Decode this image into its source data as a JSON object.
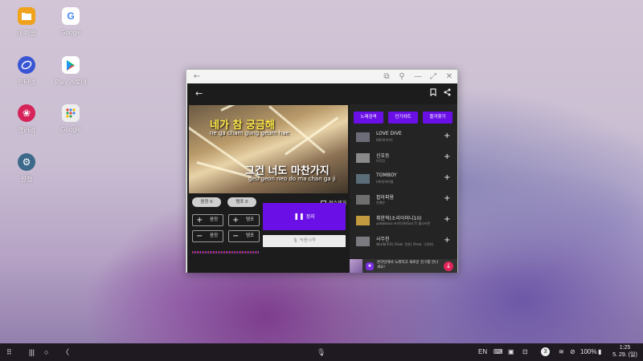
{
  "desktop": {
    "icons": [
      {
        "label": "내 파일",
        "color": "#f0a21c",
        "glyph": "folder-icon"
      },
      {
        "label": "Google",
        "color": "#ffffff",
        "glyph": "google-icon"
      },
      {
        "label": "인터넷",
        "color": "#3a55d4",
        "glyph": "internet-icon"
      },
      {
        "label": "Play 스토어",
        "color": "#ffffff",
        "glyph": "play-store-icon"
      },
      {
        "label": "갤러리",
        "color": "#d6235a",
        "glyph": "gallery-icon"
      },
      {
        "label": "Google",
        "color": "#ffffff",
        "glyph": "google-apps-folder-icon"
      },
      {
        "label": "설정",
        "color": "#3d6a8a",
        "glyph": "settings-icon"
      }
    ]
  },
  "app": {
    "video": {
      "lyric_line1": "네가 참 궁금해",
      "lyric_line1_roman": "ne ga cham gung geum hae",
      "lyric_line2": "그건 너도 마찬가지",
      "lyric_line2_roman": "geu geon neo do ma chan ga ji"
    },
    "volume_pill": "음정 0",
    "tempo_pill": "템포 0",
    "score_checkbox": "점수제거",
    "controls": {
      "pitch_up": "음정",
      "tempo_up": "템포",
      "pitch_down": "음정",
      "tempo_down": "템포"
    },
    "stop_button": "정지",
    "record_button": "녹음시작",
    "tabs": [
      "노래검색",
      "인기차트",
      "즐겨찾기"
    ],
    "songs": [
      {
        "name": "LOVE DIVE",
        "artist": "IVE(아이브)",
        "thumb": "#6c6c78"
      },
      {
        "name": "신호등",
        "artist": "이무진",
        "thumb": "#8a8a8a"
      },
      {
        "name": "TOMBOY",
        "artist": "(여자)아이들",
        "thumb": "#5c6d7a"
      },
      {
        "name": "팝아피용",
        "artist": "안예은",
        "thumb": "#6e6e6e"
      },
      {
        "name": "취한척(소리아미니10)",
        "artist": "yokobiano 코리언셔(Gon.T) 황소비린",
        "thumb": "#c49a40"
      },
      {
        "name": "사무친",
        "artist": "배다해(주로) (Feat. 윤한) (Prod. 그루비)",
        "thumb": "#7a7a80"
      }
    ],
    "banner_text": "온라인에서 노래하고 새로운 친구를 만나세요!",
    "accent_color": "#6a10e6"
  },
  "taskbar": {
    "lang": "EN",
    "notif_count": "3",
    "battery": "100%",
    "time": "1:25",
    "date": "5. 29. (일)"
  }
}
